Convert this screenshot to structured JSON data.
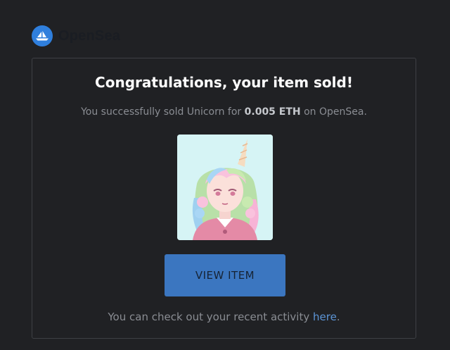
{
  "brand": {
    "name": "OpenSea",
    "logo_icon": "boat-icon",
    "accent_color": "#2f7fdd"
  },
  "email": {
    "title": "Congratulations, your item sold!",
    "message_prefix": "You successfully sold Unicorn for ",
    "price": "0.005 ETH",
    "message_suffix": " on OpenSea.",
    "item_image": "unicorn-avatar-image",
    "view_button_label": "VIEW ITEM",
    "footer_prefix": "You can check out your recent activity ",
    "footer_link": "here",
    "footer_suffix": "."
  }
}
